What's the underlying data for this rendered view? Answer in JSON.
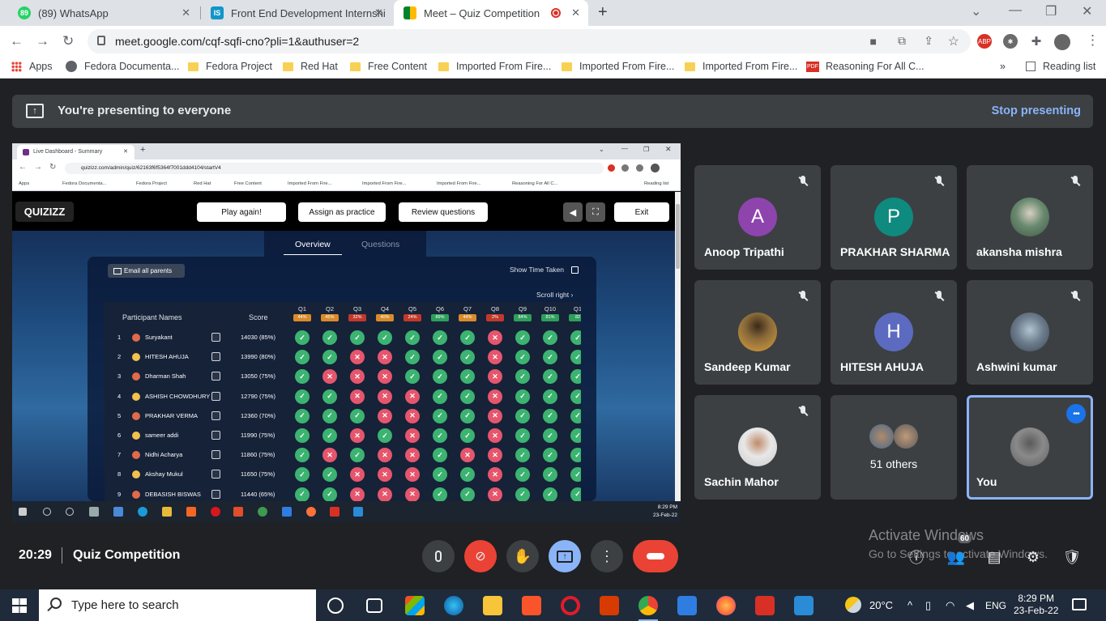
{
  "browser": {
    "tabs": [
      {
        "title": "(89) WhatsApp",
        "favicon": "whatsapp-icon",
        "active": false
      },
      {
        "title": "Front End Development Internshi",
        "favicon": "internshala-icon",
        "active": false
      },
      {
        "title": "Meet – Quiz Competition",
        "favicon": "meet-icon",
        "active": true
      }
    ],
    "url": "meet.google.com/cqf-sqfi-cno?pli=1&authuser=2",
    "bookmarks": [
      "Apps",
      "Fedora Documenta...",
      "Fedora Project",
      "Red Hat",
      "Free Content",
      "Imported From Fire...",
      "Imported From Fire...",
      "Imported From Fire...",
      "Reasoning For All C..."
    ],
    "reading_list": "Reading list"
  },
  "presenting": {
    "text": "You're presenting to everyone",
    "stop": "Stop presenting"
  },
  "shared_screen": {
    "tab_title": "Live Dashboard - Summary",
    "url": "quizizz.com/admin/quiz/62163f6f5364f7001ddd4104/startV4",
    "bookmarks": [
      "Apps",
      "Fedora Documenta...",
      "Fedora Project",
      "Red Hat",
      "Free Content",
      "Imported From Fire...",
      "Imported From Fire...",
      "Imported From Fire...",
      "Reasoning For All C..."
    ],
    "reading_list": "Reading list",
    "logo": "QUIZIZZ",
    "buttons": {
      "play_again": "Play again!",
      "assign": "Assign as practice",
      "review": "Review questions",
      "exit": "Exit"
    },
    "tabs": {
      "overview": "Overview",
      "questions": "Questions"
    },
    "email_parents": "Email all parents",
    "show_time": "Show Time Taken",
    "scroll_right": "Scroll right",
    "col_names": "Participant Names",
    "col_score": "Score",
    "questions": [
      {
        "q": "Q1",
        "pct": "44%"
      },
      {
        "q": "Q2",
        "pct": "45%"
      },
      {
        "q": "Q3",
        "pct": "32%"
      },
      {
        "q": "Q4",
        "pct": "40%"
      },
      {
        "q": "Q5",
        "pct": "24%"
      },
      {
        "q": "Q6",
        "pct": "89%"
      },
      {
        "q": "Q7",
        "pct": "44%"
      },
      {
        "q": "Q8",
        "pct": "2%"
      },
      {
        "q": "Q9",
        "pct": "84%"
      },
      {
        "q": "Q10",
        "pct": "81%"
      },
      {
        "q": "Q1",
        "pct": "82"
      }
    ],
    "participants": [
      {
        "rank": "1",
        "name": "Suryakant",
        "score": "14030 (85%)",
        "answers": [
          1,
          1,
          1,
          1,
          1,
          1,
          1,
          0,
          1,
          1,
          1
        ]
      },
      {
        "rank": "2",
        "name": "HITESH AHUJA",
        "score": "13990 (80%)",
        "answers": [
          1,
          1,
          0,
          0,
          1,
          1,
          1,
          0,
          1,
          1,
          1
        ]
      },
      {
        "rank": "3",
        "name": "Dharman Shah",
        "score": "13050 (75%)",
        "answers": [
          1,
          0,
          0,
          0,
          1,
          1,
          1,
          0,
          1,
          1,
          1
        ]
      },
      {
        "rank": "4",
        "name": "ASHISH CHOWDHURY",
        "score": "12790 (75%)",
        "answers": [
          1,
          1,
          0,
          0,
          0,
          1,
          1,
          0,
          1,
          1,
          1
        ]
      },
      {
        "rank": "5",
        "name": "PRAKHAR VERMA",
        "score": "12360 (70%)",
        "answers": [
          1,
          1,
          1,
          0,
          0,
          1,
          1,
          0,
          1,
          1,
          1
        ]
      },
      {
        "rank": "6",
        "name": "sameer addi",
        "score": "11990 (75%)",
        "answers": [
          1,
          1,
          0,
          1,
          0,
          1,
          1,
          0,
          1,
          1,
          1
        ]
      },
      {
        "rank": "7",
        "name": "Nidhi Acharya",
        "score": "11860 (75%)",
        "answers": [
          1,
          0,
          1,
          0,
          0,
          1,
          0,
          0,
          1,
          1,
          1
        ]
      },
      {
        "rank": "8",
        "name": "Akshay Mukul",
        "score": "11650 (75%)",
        "answers": [
          1,
          1,
          0,
          0,
          0,
          1,
          1,
          0,
          1,
          1,
          1
        ]
      },
      {
        "rank": "9",
        "name": "DEBASISH BISWAS",
        "score": "11440 (65%)",
        "answers": [
          1,
          1,
          0,
          0,
          0,
          1,
          1,
          0,
          1,
          1,
          1
        ]
      }
    ],
    "clock_time": "8:29 PM",
    "clock_date": "23-Feb-22"
  },
  "participants": [
    {
      "name": "Anoop Tripathi",
      "initial": "A",
      "color": "#8e44ad",
      "muted": true
    },
    {
      "name": "PRAKHAR SHARMA",
      "initial": "P",
      "color": "#0f8a7e",
      "muted": true
    },
    {
      "name": "akansha mishra",
      "initial": "",
      "color": "#6a8a70",
      "muted": true
    },
    {
      "name": "Sandeep Kumar",
      "initial": "",
      "color": "#8a6a3a",
      "muted": true
    },
    {
      "name": "HITESH AHUJA",
      "initial": "H",
      "color": "#5c6bc0",
      "muted": true
    },
    {
      "name": "Ashwini kumar",
      "initial": "",
      "color": "#6f7f8f",
      "muted": true
    },
    {
      "name": "Sachin Mahor",
      "initial": "",
      "color": "#c9c9c9",
      "muted": true
    },
    {
      "name": "51 others",
      "initial": "",
      "color": "#5a6a7a",
      "muted": false
    },
    {
      "name": "You",
      "initial": "",
      "color": "#7a7a7a",
      "muted": false
    }
  ],
  "meeting": {
    "time": "20:29",
    "title": "Quiz Competition",
    "people_count": "60"
  },
  "watermark": {
    "line1": "Activate Windows",
    "line2": "Go to Settings to activate Windows."
  },
  "taskbar": {
    "search_placeholder": "Type here to search",
    "weather": "20°C",
    "lang": "ENG",
    "time": "8:29 PM",
    "date": "23-Feb-22"
  },
  "colors": {
    "accent": "#8ab4f8",
    "end_call": "#ea4335",
    "present": "#8ab4f8"
  }
}
